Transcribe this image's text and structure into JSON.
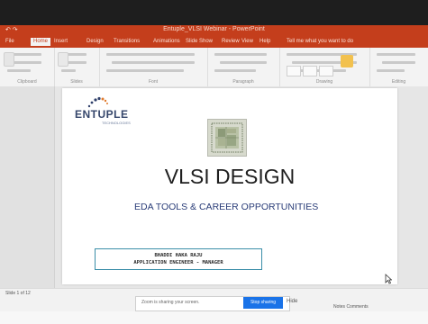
{
  "window": {
    "title": "Entuple_VLSI Webinar - PowerPoint",
    "qat": "↶ ↷"
  },
  "ribbon_tabs": [
    "File",
    "Home",
    "Insert",
    "Design",
    "Transitions",
    "Animations",
    "Slide Show",
    "Review",
    "View",
    "Help",
    "Tell me what you want to do"
  ],
  "ribbon_groups": [
    "Clipboard",
    "Slides",
    "Font",
    "Paragraph",
    "Drawing",
    "Editing"
  ],
  "slide": {
    "logo": "ENTUPLE",
    "logo_tagline": "TECHNOLOGIES",
    "title": "VLSI DESIGN",
    "subtitle": "EDA TOOLS & CAREER OPPORTUNITIES",
    "presenter_line1": "BHADDI HAKA RAJU",
    "presenter_line2": "APPLICATION ENGINEER - MANAGER"
  },
  "notification": {
    "text": "Zoom is sharing your screen.",
    "action": "Stop sharing",
    "dismiss": "Hide"
  },
  "status": {
    "left": "Slide 1 of 12",
    "right": "Notes  Comments"
  },
  "colors": {
    "accent": "#c43e1c",
    "subtitle": "#2a3d78",
    "box_border": "#3a8ea8",
    "button": "#1a73e8"
  }
}
